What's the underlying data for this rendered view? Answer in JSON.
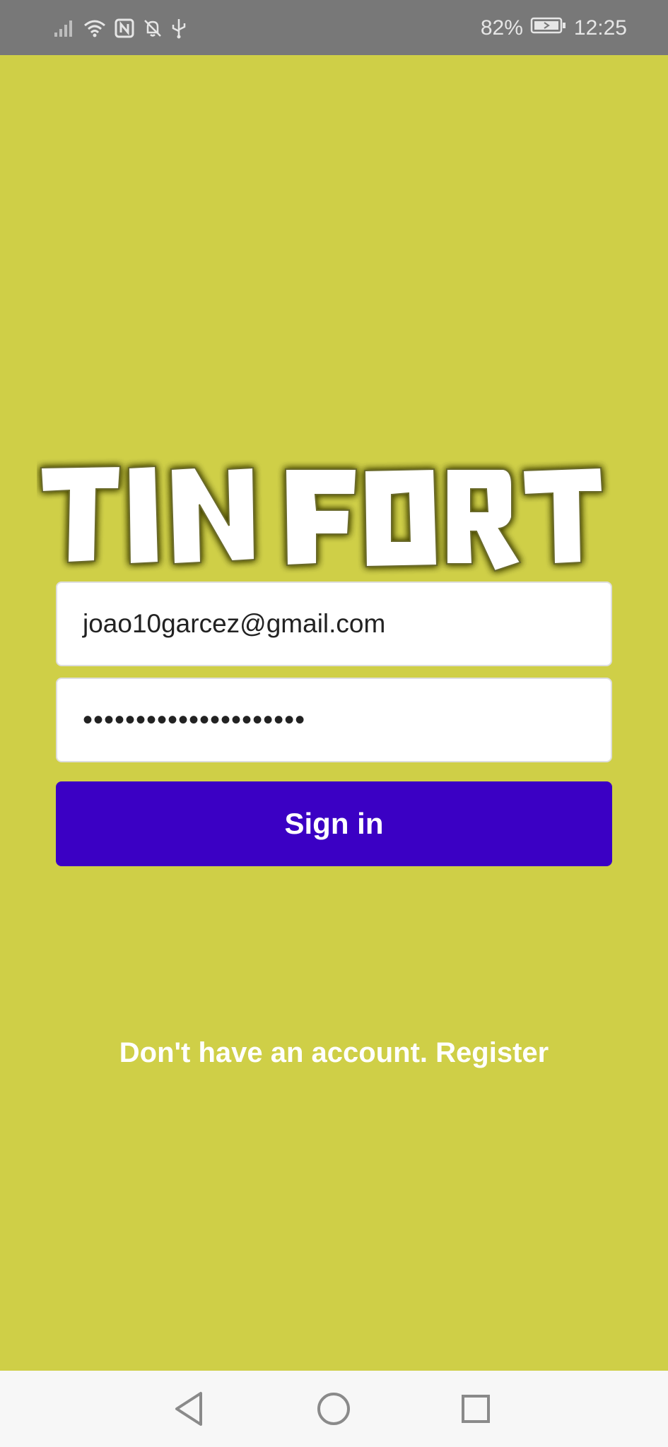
{
  "status_bar": {
    "battery_percent": "82%",
    "time": "12:25",
    "icons": [
      "signal-icon",
      "wifi-icon",
      "nfc-icon",
      "bell-muted-icon",
      "usb-icon",
      "battery-charging-icon"
    ]
  },
  "logo": {
    "text": "TINFORT"
  },
  "login_form": {
    "email_value": "joao10garcez@gmail.com",
    "password_value": "•••••••••••••••••••••",
    "signin_label": "Sign in"
  },
  "register": {
    "label": "Don't have an account. Register"
  },
  "nav_bar": {
    "icons": [
      "back-icon",
      "home-icon",
      "recents-icon"
    ]
  },
  "colors": {
    "background": "#cfcf47",
    "button": "#3b00c4",
    "status_bar": "#787878",
    "nav_bar": "#f7f7f7"
  }
}
